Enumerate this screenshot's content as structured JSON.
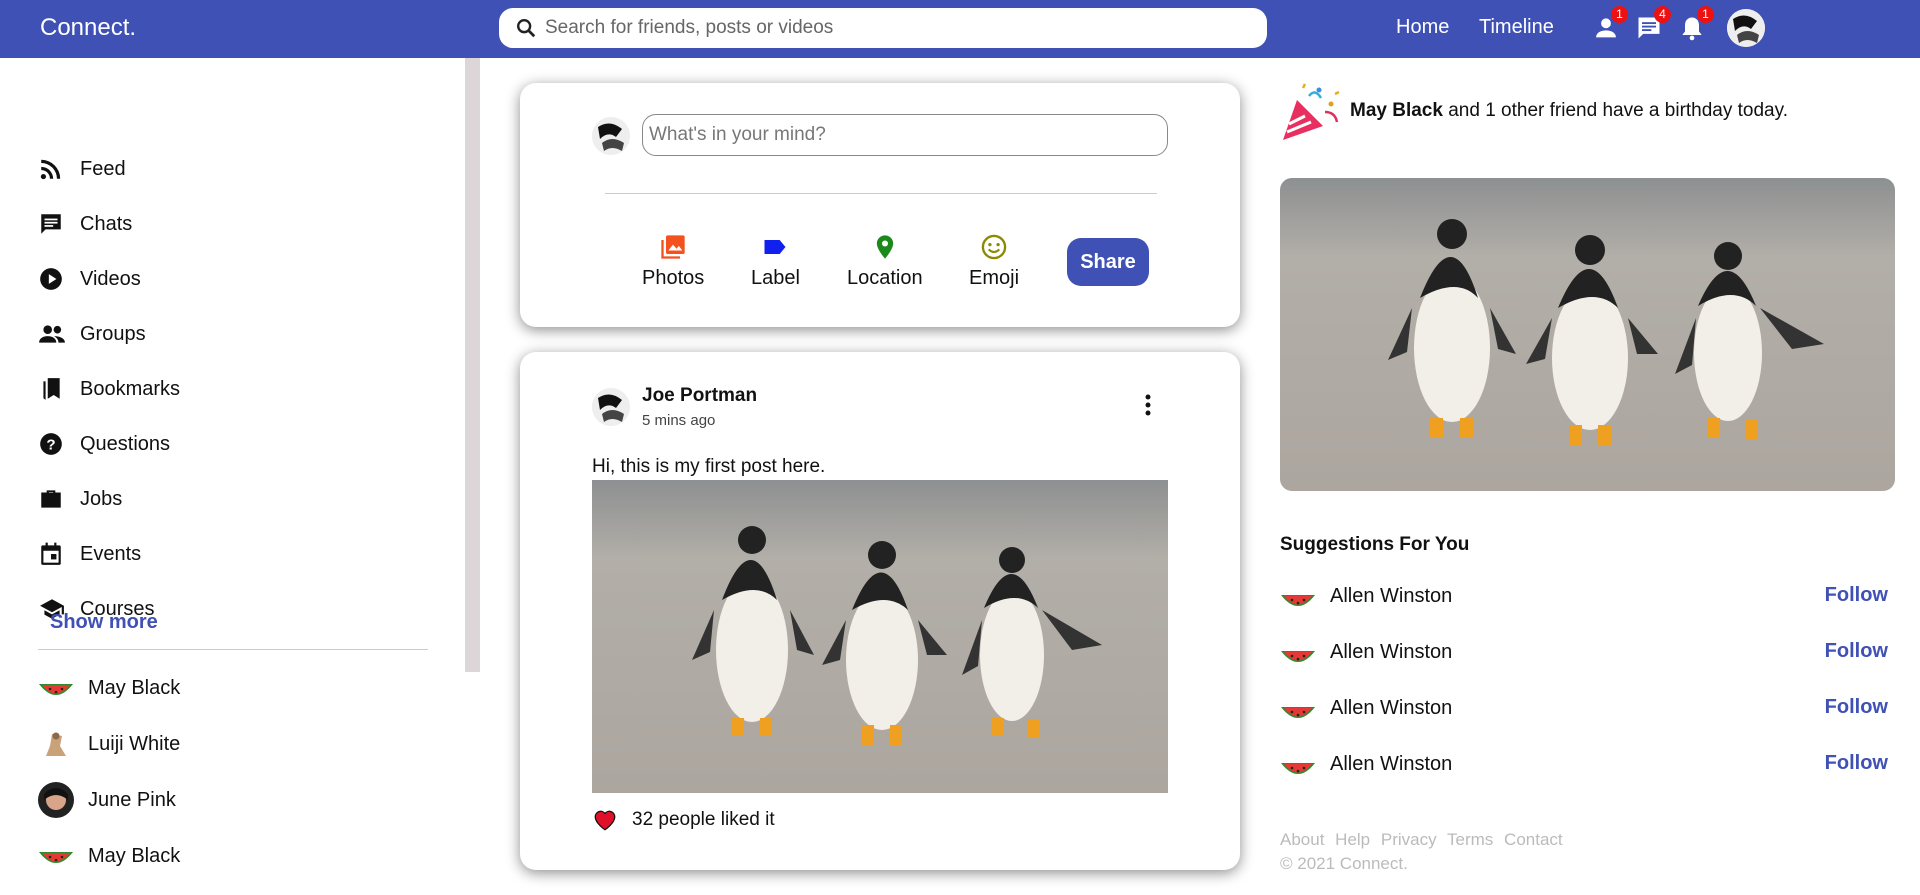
{
  "header": {
    "logo": "Connect.",
    "search_placeholder": "Search for friends, posts or videos",
    "links": [
      "Home",
      "Timeline"
    ],
    "badges": {
      "friends": "1",
      "messages": "4",
      "notifications": "1"
    }
  },
  "sidebar": {
    "items": [
      {
        "label": "Feed",
        "icon": "rss-icon"
      },
      {
        "label": "Chats",
        "icon": "chat-icon"
      },
      {
        "label": "Videos",
        "icon": "play-circle-icon"
      },
      {
        "label": "Groups",
        "icon": "group-icon"
      },
      {
        "label": "Bookmarks",
        "icon": "bookmark-icon"
      },
      {
        "label": "Questions",
        "icon": "help-icon"
      },
      {
        "label": "Jobs",
        "icon": "briefcase-icon"
      },
      {
        "label": "Events",
        "icon": "calendar-icon"
      },
      {
        "label": "Courses",
        "icon": "school-icon"
      }
    ],
    "show_more": "Show more",
    "friends": [
      "May Black",
      "Luiji White",
      "June Pink",
      "May Black"
    ]
  },
  "share": {
    "placeholder": "What's in your mind?",
    "options": [
      "Photos",
      "Label",
      "Location",
      "Emoji"
    ],
    "button": "Share"
  },
  "post": {
    "author": "Joe Portman",
    "time": "5 mins ago",
    "text": "Hi, this is my first post here.",
    "likes_text": "32 people liked it"
  },
  "right": {
    "birthday_name": "May Black",
    "birthday_rest": " and 1 other friend have a birthday today.",
    "suggestions_title": "Suggestions For You",
    "suggestions": [
      {
        "name": "Allen Winston",
        "action": "Follow"
      },
      {
        "name": "Allen Winston",
        "action": "Follow"
      },
      {
        "name": "Allen Winston",
        "action": "Follow"
      },
      {
        "name": "Allen Winston",
        "action": "Follow"
      }
    ],
    "footer_links": [
      "About",
      "Help",
      "Privacy",
      "Terms",
      "Contact"
    ],
    "copyright": "© 2021 Connect."
  },
  "colors": {
    "brand": "#3f51b5",
    "badge": "#ee1111"
  }
}
